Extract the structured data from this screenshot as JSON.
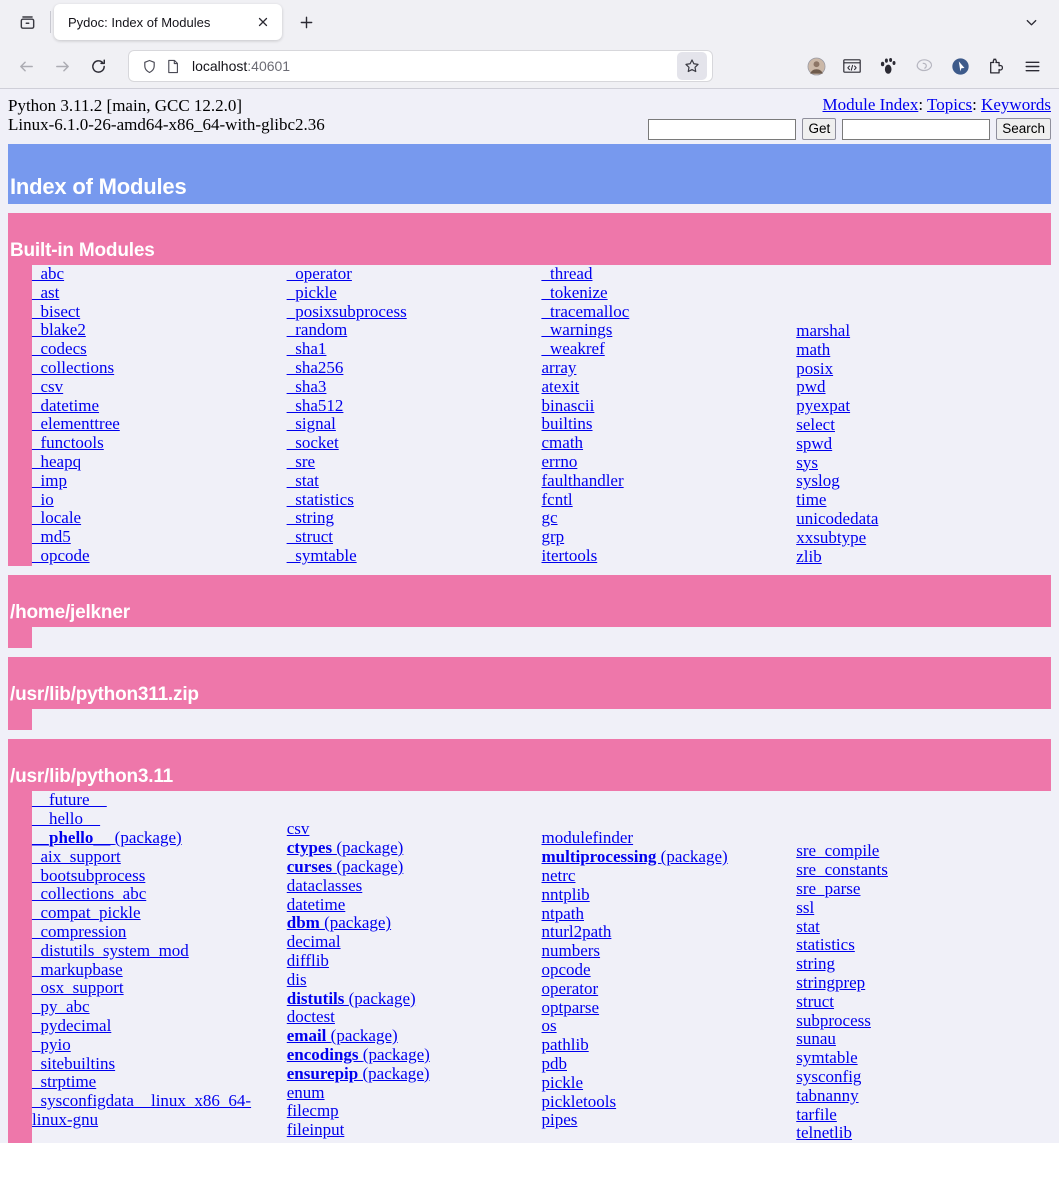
{
  "browser": {
    "tab_title": "Pydoc: Index of Modules",
    "url_host": "localhost",
    "url_port": ":40601",
    "icons": {
      "tab_list": "tab-list-icon",
      "close": "close-icon",
      "new_tab": "plus-icon",
      "overflow": "chevron-down-icon",
      "back": "back-arrow-icon",
      "forward": "forward-arrow-icon",
      "reload": "reload-icon",
      "shield": "shield-icon",
      "page": "page-document-icon",
      "bookmark": "star-icon",
      "account": "account-avatar-icon",
      "devtools": "devtools-icon",
      "gnome": "gnome-footprint-icon",
      "adblock": "adblock-icon",
      "pointer": "pointer-circle-icon",
      "extensions": "extensions-puzzle-icon",
      "menu": "hamburger-menu-icon"
    }
  },
  "page": {
    "platform_line1": "Python 3.11.2 [main, GCC 12.2.0]",
    "platform_line2": "Linux-6.1.0-26-amd64-x86_64-with-glibc2.36",
    "nav_links": [
      "Module Index",
      "Topics",
      "Keywords"
    ],
    "nav_separator": ":",
    "get_input_value": "",
    "get_button": "Get",
    "search_input_value": "",
    "search_button": "Search",
    "title": "Index of Modules",
    "colors": {
      "title_banner": "#7799ee",
      "section_banner": "#ee77aa",
      "page_background": "#f0f0f8",
      "link": "#0000ee"
    }
  },
  "sections": [
    {
      "heading": "Built-in Modules",
      "columns": [
        [
          {
            "name": "_abc"
          },
          {
            "name": "_ast"
          },
          {
            "name": "_bisect"
          },
          {
            "name": "_blake2"
          },
          {
            "name": "_codecs"
          },
          {
            "name": "_collections"
          },
          {
            "name": "_csv"
          },
          {
            "name": "_datetime"
          },
          {
            "name": "_elementtree"
          },
          {
            "name": "_functools"
          },
          {
            "name": "_heapq"
          },
          {
            "name": "_imp"
          },
          {
            "name": "_io"
          },
          {
            "name": "_locale"
          },
          {
            "name": "_md5"
          },
          {
            "name": "_opcode"
          }
        ],
        [
          {
            "name": "_operator"
          },
          {
            "name": "_pickle"
          },
          {
            "name": "_posixsubprocess"
          },
          {
            "name": "_random"
          },
          {
            "name": "_sha1"
          },
          {
            "name": "_sha256"
          },
          {
            "name": "_sha3"
          },
          {
            "name": "_sha512"
          },
          {
            "name": "_signal"
          },
          {
            "name": "_socket"
          },
          {
            "name": "_sre"
          },
          {
            "name": "_stat"
          },
          {
            "name": "_statistics"
          },
          {
            "name": "_string"
          },
          {
            "name": "_struct"
          },
          {
            "name": "_symtable"
          }
        ],
        [
          {
            "name": "_thread"
          },
          {
            "name": "_tokenize"
          },
          {
            "name": "_tracemalloc"
          },
          {
            "name": "_warnings"
          },
          {
            "name": "_weakref"
          },
          {
            "name": "array"
          },
          {
            "name": "atexit"
          },
          {
            "name": "binascii"
          },
          {
            "name": "builtins"
          },
          {
            "name": "cmath"
          },
          {
            "name": "errno"
          },
          {
            "name": "faulthandler"
          },
          {
            "name": "fcntl"
          },
          {
            "name": "gc"
          },
          {
            "name": "grp"
          },
          {
            "name": "itertools"
          }
        ],
        [
          {
            "name": "marshal"
          },
          {
            "name": "math"
          },
          {
            "name": "posix"
          },
          {
            "name": "pwd"
          },
          {
            "name": "pyexpat"
          },
          {
            "name": "select"
          },
          {
            "name": "spwd"
          },
          {
            "name": "sys"
          },
          {
            "name": "syslog"
          },
          {
            "name": "time"
          },
          {
            "name": "unicodedata"
          },
          {
            "name": "xxsubtype"
          },
          {
            "name": "zlib"
          }
        ]
      ],
      "column_offsets": [
        0,
        0,
        0,
        57
      ]
    },
    {
      "heading": "/home/jelkner",
      "columns": [
        [],
        [],
        [],
        []
      ],
      "column_offsets": [
        0,
        0,
        0,
        0
      ],
      "empty": true
    },
    {
      "heading": "/usr/lib/python311.zip",
      "columns": [
        [],
        [],
        [],
        []
      ],
      "column_offsets": [
        0,
        0,
        0,
        0
      ],
      "empty": true
    },
    {
      "heading": "/usr/lib/python3.11",
      "columns": [
        [
          {
            "name": "__future__"
          },
          {
            "name": "__hello__"
          },
          {
            "name": "__phello__",
            "package": true,
            "tag": "(package)"
          },
          {
            "name": "_aix_support"
          },
          {
            "name": "_bootsubprocess"
          },
          {
            "name": "_collections_abc"
          },
          {
            "name": "_compat_pickle"
          },
          {
            "name": "_compression"
          },
          {
            "name": "_distutils_system_mod"
          },
          {
            "name": "_markupbase"
          },
          {
            "name": "_osx_support"
          },
          {
            "name": "_py_abc"
          },
          {
            "name": "_pydecimal"
          },
          {
            "name": "_pyio"
          },
          {
            "name": "_sitebuiltins"
          },
          {
            "name": "_strptime"
          },
          {
            "name": "_sysconfigdata__linux_x86_64-linux-gnu",
            "wrapped": true
          }
        ],
        [
          {
            "name": "csv"
          },
          {
            "name": "ctypes",
            "package": true,
            "tag": "(package)"
          },
          {
            "name": "curses",
            "package": true,
            "tag": "(package)"
          },
          {
            "name": "dataclasses"
          },
          {
            "name": "datetime"
          },
          {
            "name": "dbm",
            "package": true,
            "tag": "(package)"
          },
          {
            "name": "decimal"
          },
          {
            "name": "difflib"
          },
          {
            "name": "dis"
          },
          {
            "name": "distutils",
            "package": true,
            "tag": "(package)"
          },
          {
            "name": "doctest"
          },
          {
            "name": "email",
            "package": true,
            "tag": "(package)"
          },
          {
            "name": "encodings",
            "package": true,
            "tag": "(package)"
          },
          {
            "name": "ensurepip",
            "package": true,
            "tag": "(package)"
          },
          {
            "name": "enum"
          },
          {
            "name": "filecmp"
          },
          {
            "name": "fileinput"
          }
        ],
        [
          {
            "name": "modulefinder"
          },
          {
            "name": "multiprocessing",
            "package": true,
            "tag": "(package)"
          },
          {
            "name": "netrc"
          },
          {
            "name": "nntplib"
          },
          {
            "name": "ntpath"
          },
          {
            "name": "nturl2path"
          },
          {
            "name": "numbers"
          },
          {
            "name": "opcode"
          },
          {
            "name": "operator"
          },
          {
            "name": "optparse"
          },
          {
            "name": "os"
          },
          {
            "name": "pathlib"
          },
          {
            "name": "pdb"
          },
          {
            "name": "pickle"
          },
          {
            "name": "pickletools"
          },
          {
            "name": "pipes"
          }
        ],
        [
          {
            "name": "sre_compile"
          },
          {
            "name": "sre_constants"
          },
          {
            "name": "sre_parse"
          },
          {
            "name": "ssl"
          },
          {
            "name": "stat"
          },
          {
            "name": "statistics"
          },
          {
            "name": "string"
          },
          {
            "name": "stringprep"
          },
          {
            "name": "struct"
          },
          {
            "name": "subprocess"
          },
          {
            "name": "sunau"
          },
          {
            "name": "symtable"
          },
          {
            "name": "sysconfig"
          },
          {
            "name": "tabnanny"
          },
          {
            "name": "tarfile"
          },
          {
            "name": "telnetlib"
          }
        ]
      ],
      "column_offsets": [
        0,
        29,
        38,
        51
      ]
    }
  ]
}
